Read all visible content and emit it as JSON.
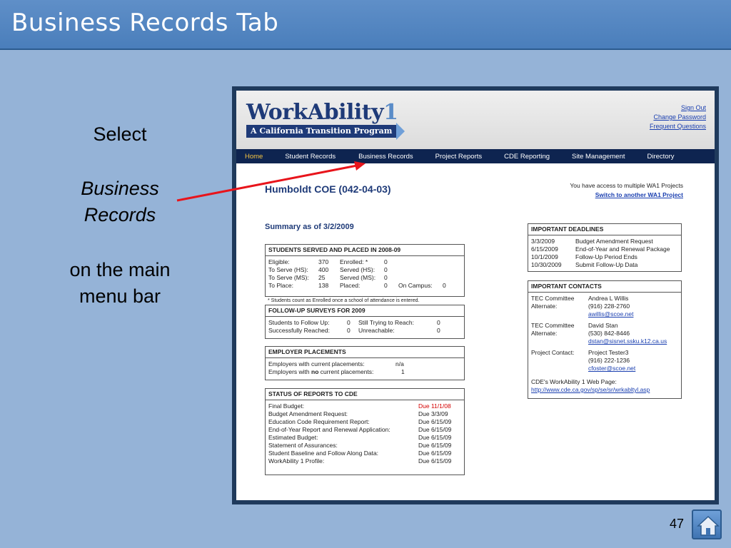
{
  "slide": {
    "title": "Business Records Tab",
    "instruction": {
      "line1": "Select",
      "italic1": "Business",
      "italic2": "Records",
      "line3": "on the main",
      "line4": "menu bar"
    },
    "page_number": "47"
  },
  "app": {
    "logo": {
      "word1": "Work",
      "word2": "Ability",
      "num": "1",
      "tagline": "A California Transition Program"
    },
    "top_links": [
      "Sign Out",
      "Change Password",
      "Frequent Questions"
    ],
    "nav": [
      "Home",
      "Student Records",
      "Business Records",
      "Project Reports",
      "CDE Reporting",
      "Site Management",
      "Directory"
    ],
    "org_title": "Humboldt COE (042-04-03)",
    "access_text": "You have access to multiple WA1 Projects",
    "switch_link": "Switch to another WA1 Project",
    "summary_title": "Summary as of 3/2/2009",
    "students": {
      "header": "STUDENTS SERVED AND PLACED IN 2008-09",
      "rows": [
        [
          "Eligible:",
          "370",
          "Enrolled: *",
          "0",
          "",
          ""
        ],
        [
          "To Serve (HS):",
          "400",
          "Served (HS):",
          "0",
          "",
          ""
        ],
        [
          "To Serve (MS):",
          "25",
          "Served (MS):",
          "0",
          "",
          ""
        ],
        [
          "To Place:",
          "138",
          "Placed:",
          "0",
          "On Campus:",
          "0"
        ]
      ],
      "footnote": "* Students count as Enrolled once a school of attendance is entered."
    },
    "followup": {
      "header": "FOLLOW-UP SURVEYS FOR 2009",
      "rows": [
        [
          "Students to Follow Up:",
          "0",
          "Still Trying to Reach:",
          "0"
        ],
        [
          "Successfully Reached:",
          "0",
          "Unreachable:",
          "0"
        ]
      ]
    },
    "employer": {
      "header": "EMPLOYER PLACEMENTS",
      "row1_label": "Employers with current placements:",
      "row1_value": "n/a",
      "row2_pre": "Employers with ",
      "row2_bold": "no",
      "row2_post": " current placements:",
      "row2_value": "1"
    },
    "reports": {
      "header": "STATUS OF REPORTS TO CDE",
      "rows": [
        [
          "Final Budget:",
          "Due 11/1/08"
        ],
        [
          "Budget Amendment Request:",
          "Due 3/3/09"
        ],
        [
          "Education Code Requirement Report:",
          "Due 6/15/09"
        ],
        [
          "End-of-Year Report and Renewal Application:",
          "Due 6/15/09"
        ],
        [
          "Estimated Budget:",
          "Due 6/15/09"
        ],
        [
          "Statement of Assurances:",
          "Due 6/15/09"
        ],
        [
          "Student Baseline and Follow Along Data:",
          "Due 6/15/09"
        ],
        [
          "WorkAbility 1 Profile:",
          "Due 6/15/09"
        ]
      ]
    },
    "deadlines": {
      "header": "IMPORTANT DEADLINES",
      "rows": [
        [
          "3/3/2009",
          "Budget Amendment Request"
        ],
        [
          "6/15/2009",
          "End-of-Year and Renewal Package"
        ],
        [
          "10/1/2009",
          "Follow-Up Period Ends"
        ],
        [
          "10/30/2009",
          "Submit Follow-Up Data"
        ]
      ]
    },
    "contacts": {
      "header": "IMPORTANT CONTACTS",
      "c1_role": "TEC Committee",
      "c1_name": "Andrea L Willis",
      "c1_alt": "Alternate:",
      "c1_phone": "(916) 228-2760",
      "c1_email": "awillis@scoe.net",
      "c2_role": "TEC Committee",
      "c2_name": "David Stan",
      "c2_alt": "Alternate:",
      "c2_phone": "(530) 842-8446",
      "c2_email": "dstan@sisnet.ssku.k12.ca.us",
      "c3_role": "Project Contact:",
      "c3_name": "Project Tester3",
      "c3_phone": "(916) 222-1236",
      "c3_email": "cfoster@scoe.net",
      "web_label": "CDE's WorkAbility 1 Web Page:",
      "web_url": "http://www.cde.ca.gov/sp/se/sr/wrkabltyl.asp"
    }
  },
  "colors": {
    "slide_bg": "#95b3d7",
    "title_bar": "#4a7ebb",
    "nav_bg": "#0e2450",
    "arrow": "#e8141b",
    "heading_blue": "#1e3a78"
  }
}
